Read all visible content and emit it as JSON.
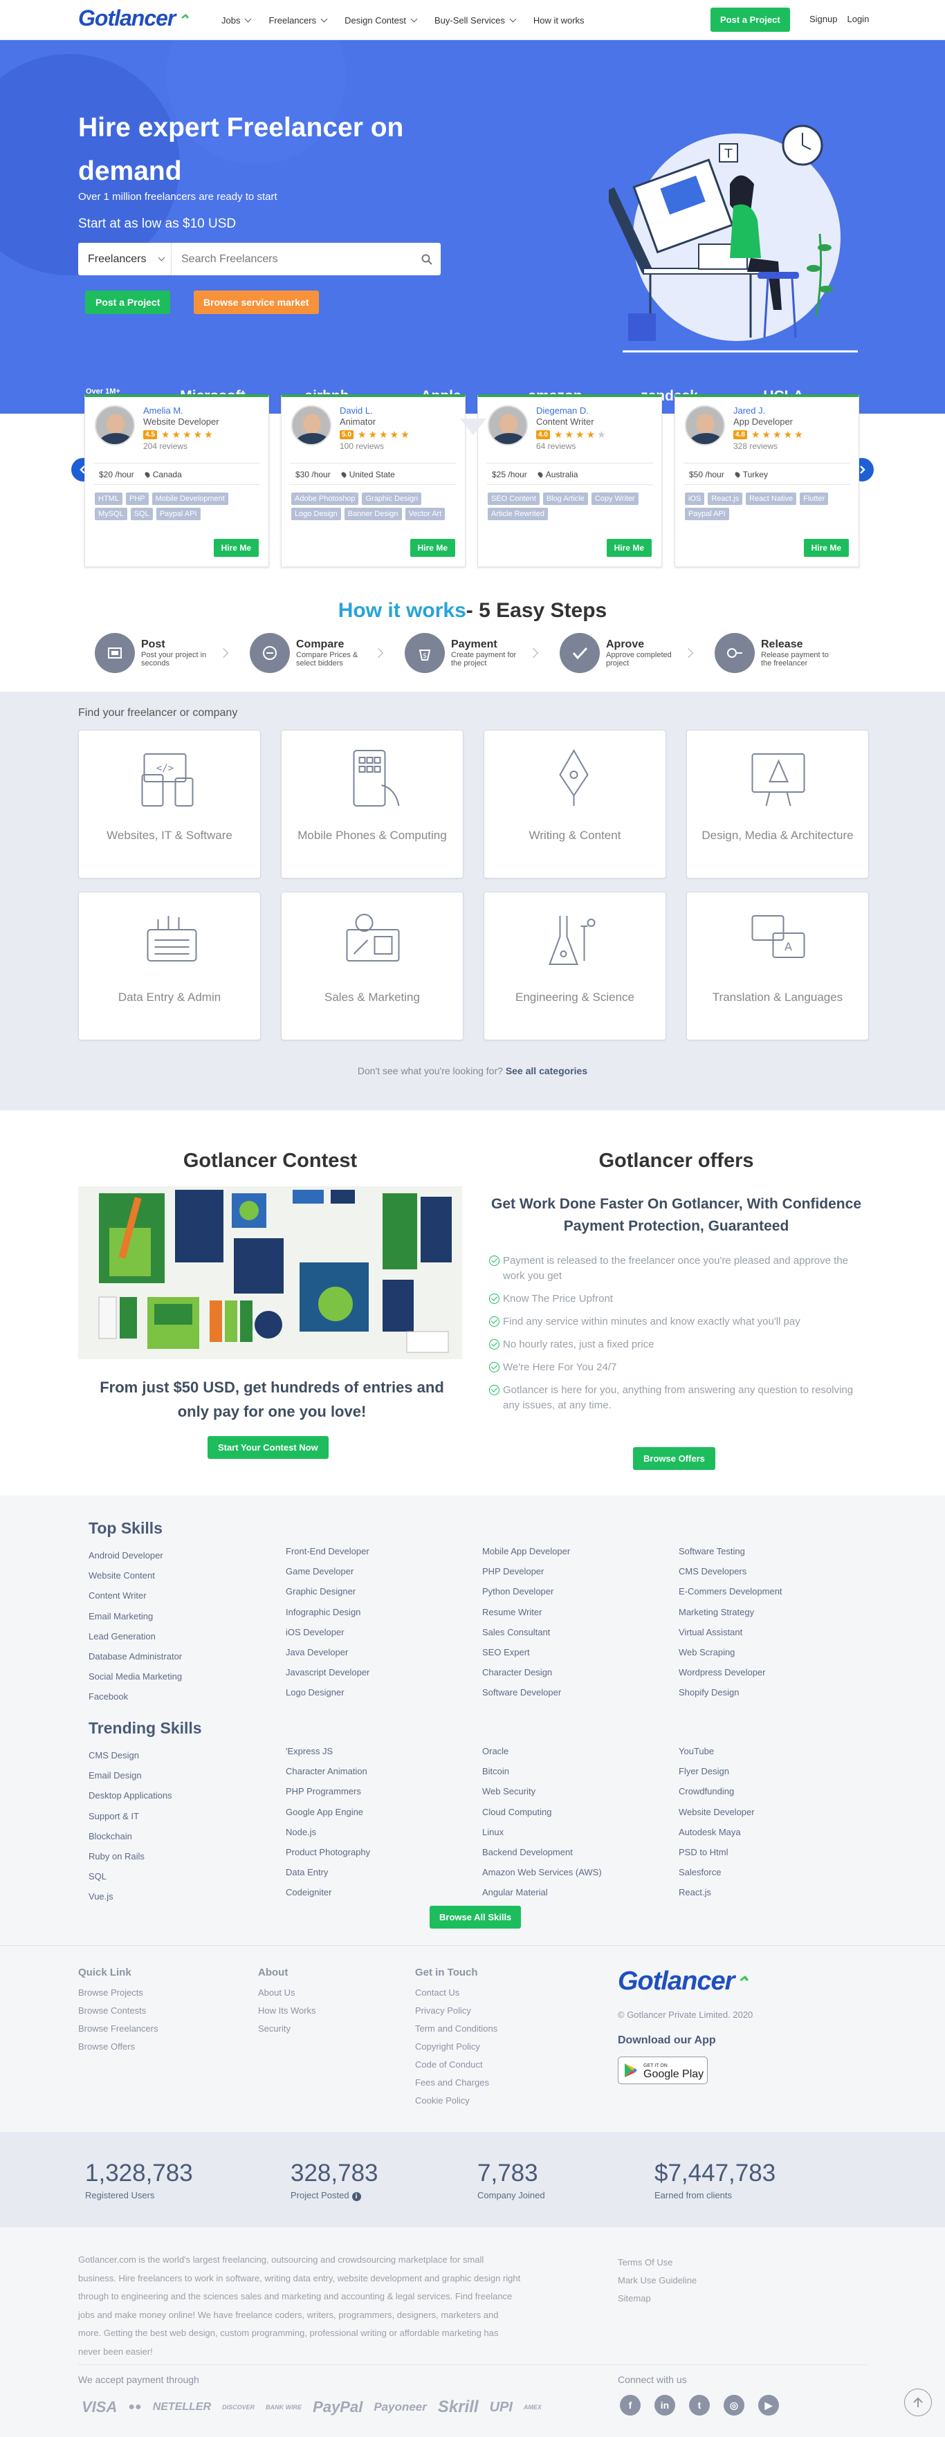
{
  "header": {
    "logo": "Gotlancer",
    "nav": [
      {
        "label": "Jobs",
        "dropdown": true
      },
      {
        "label": "Freelancers",
        "dropdown": true
      },
      {
        "label": "Design Contest",
        "dropdown": true
      },
      {
        "label": "Buy-Sell Services",
        "dropdown": true
      },
      {
        "label": "How it works",
        "dropdown": false
      }
    ],
    "post_project": "Post a Project",
    "signup": "Signup",
    "login": "Login"
  },
  "hero": {
    "title": "Hire expert Freelancer on demand",
    "subtitle": "Over 1 million freelancers are ready to start",
    "price": "Start at as low as $10 USD",
    "search_select": "Freelancers",
    "search_placeholder": "Search Freelancers",
    "btn_post": "Post a Project",
    "btn_browse": "Browse service market",
    "trust": "Over 1M+ business Trust us",
    "brands": [
      "Microsoft",
      "airbnb",
      "Apple",
      "amazon",
      "zendesk",
      "UCLA"
    ]
  },
  "freelancers": [
    {
      "name": "Amelia M.",
      "role": "Website Developer",
      "score": "4.5",
      "stars": 5,
      "reviews": "204 reviews",
      "rate": "$20 /hour",
      "location": "Canada",
      "tags": [
        "HTML",
        "PHP",
        "Mobile Development",
        "MySQL",
        "SQL",
        "Paypal API"
      ],
      "hire": "Hire Me"
    },
    {
      "name": "David L.",
      "role": "Animator",
      "score": "5.0",
      "stars": 5,
      "reviews": "100 reviews",
      "rate": "$30 /hour",
      "location": "United State",
      "tags": [
        "Adobe Photoshop",
        "Graphic Design",
        "Logo Design",
        "Banner Design",
        "Vector Art"
      ],
      "hire": "Hire Me"
    },
    {
      "name": "Diegeman D.",
      "role": "Content Writer",
      "score": "4.0",
      "stars": 4,
      "reviews": "64 reviews",
      "rate": "$25 /hour",
      "location": "Australia",
      "tags": [
        "SEO Content",
        "Blog Article",
        "Copy Writer",
        "Article Rewrited"
      ],
      "hire": "Hire Me"
    },
    {
      "name": "Jared J.",
      "role": "App Developer",
      "score": "4.8",
      "stars": 5,
      "reviews": "328 reviews",
      "rate": "$50 /hour",
      "location": "Turkey",
      "tags": [
        "iOS",
        "React.js",
        "React Native",
        "Flutter",
        "Paypal API"
      ],
      "hire": "Hire Me"
    }
  ],
  "how": {
    "title_highlight": "How it works",
    "title_rest": "- 5 Easy Steps",
    "steps": [
      {
        "title": "Post",
        "desc": "Post your project in seconds",
        "icon": "post-icon"
      },
      {
        "title": "Compare",
        "desc": "Compare Prices & select bidders",
        "icon": "compare-icon"
      },
      {
        "title": "Payment",
        "desc": "Create payment for the project",
        "icon": "payment-icon"
      },
      {
        "title": "Aprove",
        "desc": "Approve completed project",
        "icon": "approve-icon"
      },
      {
        "title": "Release",
        "desc": "Release payment to the freelancer",
        "icon": "release-icon"
      }
    ]
  },
  "categories": {
    "heading": "Find your freelancer or company",
    "items": [
      "Websites, IT & Software",
      "Mobile Phones & Computing",
      "Writing & Content",
      "Design, Media & Architecture",
      "Data Entry & Admin",
      "Sales & Marketing",
      "Engineering & Science",
      "Translation & Languages"
    ],
    "footer_text": "Don't see what you're looking for?",
    "footer_link": "See all categories"
  },
  "contest": {
    "title": "Gotlancer Contest",
    "text": "From just $50 USD, get hundreds of entries and only pay for one you love!",
    "button": "Start Your Contest Now"
  },
  "offers": {
    "title": "Gotlancer offers",
    "subtitle": "Get Work Done Faster On Gotlancer, With Confidence Payment Protection, Guaranteed",
    "items": [
      "Payment is released to the freelancer once you're pleased and approve the work you get",
      "Know The Price Upfront",
      "Find any service within minutes and know exactly what you'll pay",
      "No hourly rates, just a fixed price",
      "We're Here For You 24/7",
      "Gotlancer is here for you, anything from answering any question to resolving any issues, at any time."
    ],
    "button": "Browse Offers"
  },
  "skills": {
    "top_title": "Top Skills",
    "top": [
      [
        "Android Developer",
        "Website Content",
        "Content Writer",
        "Email Marketing",
        "Lead Generation",
        "Database Administrator",
        "Social Media Marketing",
        "Facebook"
      ],
      [
        "Front-End Developer",
        "Game Developer",
        "Graphic Designer",
        "Infographic Design",
        "iOS Developer",
        "Java Developer",
        "Javascript Developer",
        "Logo Designer"
      ],
      [
        "Mobile App Developer",
        "PHP Developer",
        "Python Developer",
        "Resume Writer",
        "Sales Consultant",
        "SEO Expert",
        "Character Design",
        "Software Developer"
      ],
      [
        "Software Testing",
        "CMS Developers",
        "E-Commers Development",
        "Marketing Strategy",
        "Virtual Assistant",
        "Web Scraping",
        "Wordpress Developer",
        "Shopify Design"
      ]
    ],
    "trending_title": "Trending Skills",
    "trending": [
      [
        "CMS Design",
        "Email Design",
        "Desktop Applications",
        "Support & IT",
        "Blockchain",
        "Ruby on Rails",
        "SQL",
        "Vue.js"
      ],
      [
        "'Express JS",
        "Character Animation",
        "PHP Programmers",
        "Google App Engine",
        "Node.js",
        "Product Photography",
        "Data Entry",
        "Codeigniter"
      ],
      [
        "Oracle",
        "Bitcoin",
        "Web Security",
        "Cloud Computing",
        "Linux",
        "Backend Development",
        "Amazon Web Services (AWS)",
        "Angular Material"
      ],
      [
        "YouTube",
        "Flyer Design",
        "Crowdfunding",
        "Website Developer",
        "Autodesk Maya",
        "PSD to Html",
        "Salesforce",
        "React.js"
      ]
    ],
    "button": "Browse All Skills"
  },
  "footer": {
    "quick_title": "Quick Link",
    "quick": [
      "Browse Projects",
      "Browse Contests",
      "Browse Freelancers",
      "Browse Offers"
    ],
    "about_title": "About",
    "about": [
      "About Us",
      "How Its Works",
      "Security"
    ],
    "touch_title": "Get in Touch",
    "touch": [
      "Contact Us",
      "Privacy Policy",
      "Term and Conditions",
      "Copyright Policy",
      "Code of Conduct",
      "Fees and Charges",
      "Cookie Policy"
    ],
    "logo": "Gotlancer",
    "copyright": "© Gotlancer Private Limited. 2020",
    "app_title": "Download our App",
    "gplay_top": "GET IT ON",
    "gplay_main": "Google Play"
  },
  "stats": [
    {
      "value": "1,328,783",
      "label": "Registered Users",
      "info": false
    },
    {
      "value": "328,783",
      "label": "Project Posted",
      "info": true
    },
    {
      "value": "7,783",
      "label": "Company Joined",
      "info": false
    },
    {
      "value": "$7,447,783",
      "label": "Earned from clients",
      "info": false
    }
  ],
  "bottom": {
    "about_text": "Gotlancer.com is the world's largest freelancing, outsourcing and crowdsourcing marketplace for small business. Hire freelancers to work in software, writing data entry, website development and graphic design right through to engineering and the sciences sales and marketing and accounting & legal services. Find freelance jobs and make money online! We have freelance coders, writers, programmers, designers, marketers and more. Getting the best web design, custom programming, professional writing or affordable marketing has never been easier!",
    "legal": [
      "Terms Of Use",
      "Mark Use Guideline",
      "Sitemap"
    ],
    "pay_title": "We accept payment through",
    "payments": [
      "VISA",
      "●●",
      "NETELLER",
      "DISCOVER",
      "BANK WIRE",
      "PayPal",
      "Payoneer",
      "Skrill",
      "UPI",
      "AMEX"
    ],
    "connect_title": "Connect with us",
    "socials": [
      "f",
      "in",
      "t",
      "◎",
      "▶"
    ]
  },
  "colors": {
    "primary": "#4a74e8",
    "green": "#1dbd5d",
    "orange": "#f7923a",
    "navy": "#4a5a78"
  }
}
